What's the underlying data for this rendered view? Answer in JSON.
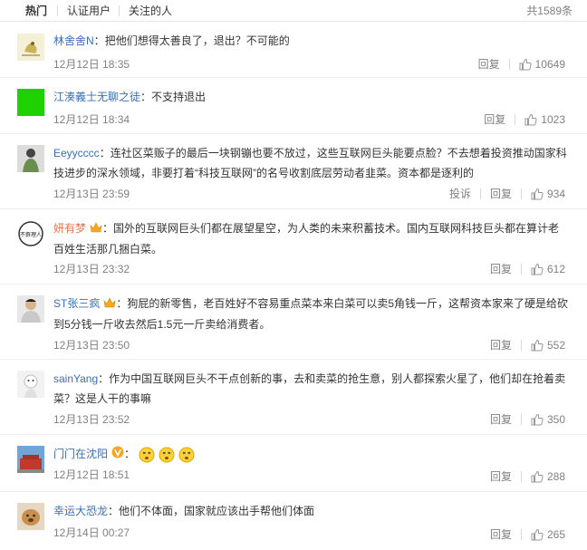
{
  "tabs": {
    "hot": "热门",
    "verified": "认证用户",
    "following": "关注的人"
  },
  "total": "共1589条",
  "actions": {
    "reply": "回复",
    "report": "投诉",
    "separator": "："
  },
  "comments": [
    {
      "user": "林舍舍N",
      "text": "把他们想得太善良了，退出？不可能的",
      "time": "12月12日 18:35",
      "likes": "10649",
      "avatar": "bird-avatar"
    },
    {
      "user": "江湊義士无聊之徒",
      "text": "不支持退出",
      "time": "12月12日 18:34",
      "likes": "1023",
      "avatar": "green-avatar"
    },
    {
      "user": "Eeyycccc",
      "text": "连社区菜贩子的最后一块钢镚也要不放过，这些互联网巨头能要点脸？不去想着投资推动国家科技进步的深水领域，非要打着“科技互联网”的名号收割底层劳动者韭菜。资本都是逐利的",
      "time": "12月13日 23:59",
      "likes": "934",
      "avatar": "person-avatar"
    },
    {
      "user": "妍有梦",
      "text": "国外的互联网巨头们都在展望星空，为人类的未来积蓄技术。国内互联网科技巨头都在算计老百姓生活那几捆白菜。",
      "time": "12月13日 23:32",
      "likes": "612",
      "avatar": "text-avatar"
    },
    {
      "user": "ST张三疯",
      "text": "狗屁的新零售，老百姓好不容易重点菜本来白菜可以卖5角钱一斤，这帮资本家来了硬是给砍到5分钱一斤收去然后1.5元一斤卖给消费者。",
      "time": "12月13日 23:50",
      "likes": "552",
      "avatar": "portrait-avatar"
    },
    {
      "user": "sainYang",
      "text": "作为中国互联网巨头不干点创新的事，去和卖菜的抢生意，别人都探索火星了，他们却在抢着卖菜？这是人干的事嘛",
      "time": "12月13日 23:52",
      "likes": "350",
      "avatar": "cartoon-avatar"
    },
    {
      "user": "门门在沈阳",
      "text": "",
      "time": "12月12日 18:51",
      "likes": "288",
      "avatar": "building-avatar"
    },
    {
      "user": "幸运大恐龙",
      "text": "他们不体面，国家就应该出手帮他们体面",
      "time": "12月14日 00:27",
      "likes": "265",
      "avatar": "dog-avatar"
    }
  ],
  "avatar_alt": {
    "avatar7_text": "不孬理人"
  }
}
